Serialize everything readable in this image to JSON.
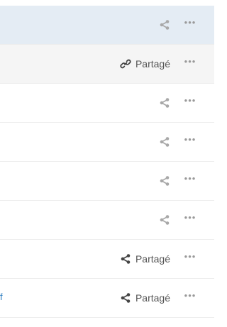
{
  "rows": [
    {
      "shared": false,
      "share_label": "",
      "selected": true,
      "icon": "share-icon"
    },
    {
      "shared": true,
      "share_label": "Partagé",
      "hovered": true,
      "icon": "link-icon"
    },
    {
      "shared": false,
      "share_label": "",
      "icon": "share-icon"
    },
    {
      "shared": false,
      "share_label": "",
      "icon": "share-icon"
    },
    {
      "shared": false,
      "share_label": "",
      "icon": "share-icon"
    },
    {
      "shared": false,
      "share_label": "",
      "icon": "share-icon"
    },
    {
      "shared": true,
      "share_label": "Partagé",
      "icon": "share-icon"
    },
    {
      "shared": true,
      "share_label": "Partagé",
      "icon": "share-icon",
      "name_fragment": "f"
    }
  ],
  "more_label": "•••",
  "colors": {
    "selected_row": "#e4ecf4",
    "hovered_row": "#f5f5f5",
    "icon_inactive": "#a8a8a8",
    "icon_active": "#444444",
    "link_text": "#2f7fc1"
  }
}
